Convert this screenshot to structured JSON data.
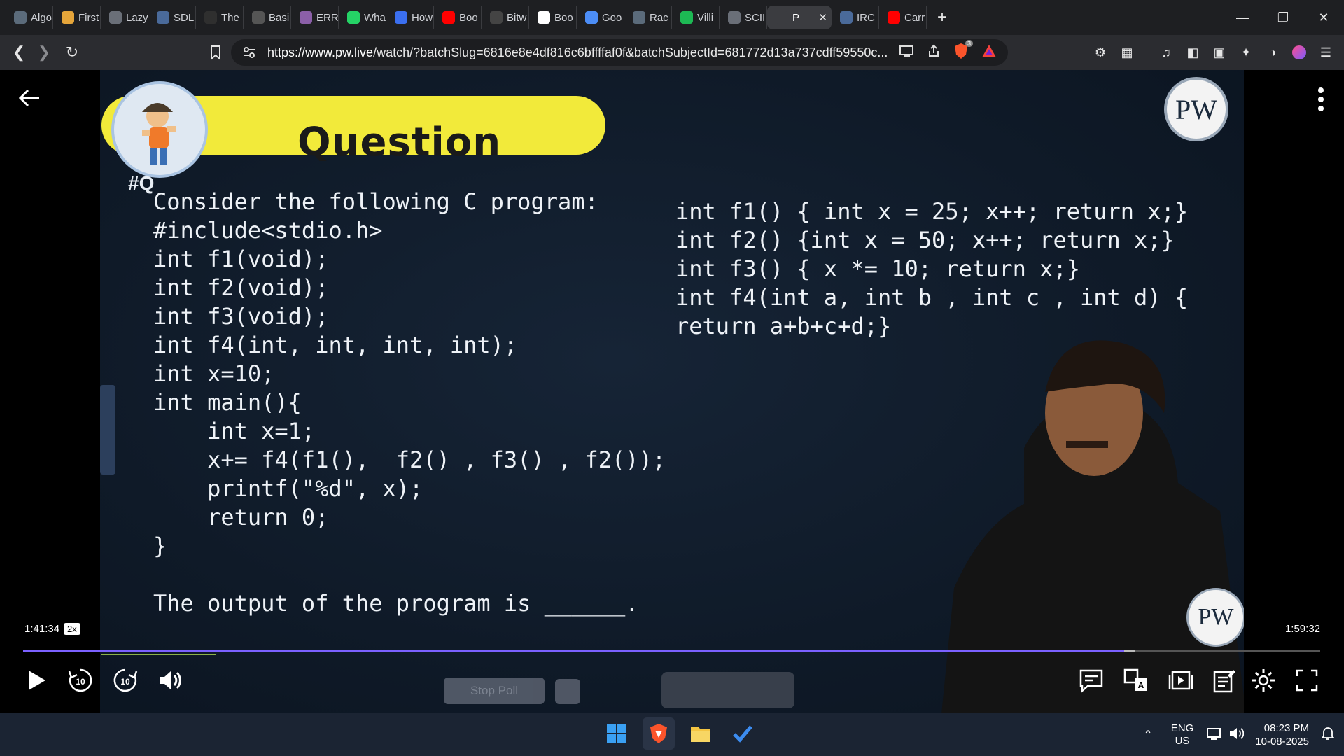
{
  "browser": {
    "tabs": [
      {
        "label": "Algo",
        "icon": "openai-icon",
        "color": "#5b6b7b"
      },
      {
        "label": "First",
        "icon": "bolt-icon",
        "color": "#e5a53a"
      },
      {
        "label": "Lazy",
        "icon": "globe-icon",
        "color": "#6a6f78"
      },
      {
        "label": "SDL",
        "icon": "image-icon",
        "color": "#4a6a9a"
      },
      {
        "label": "The",
        "icon": "w3-icon",
        "color": "#2f2f2f"
      },
      {
        "label": "Basi",
        "icon": "image-icon",
        "color": "#555"
      },
      {
        "label": "ERR",
        "icon": "mushroom-icon",
        "color": "#8b5fa8"
      },
      {
        "label": "Wha",
        "icon": "whatsapp-icon",
        "color": "#25d366"
      },
      {
        "label": "How",
        "icon": "bookmark-icon",
        "color": "#3b6ff0"
      },
      {
        "label": "Boo",
        "icon": "youtube-icon",
        "color": "#ff0000"
      },
      {
        "label": "Bitw",
        "icon": "text-icon",
        "color": "#444"
      },
      {
        "label": "Boo",
        "icon": "google-icon",
        "color": "#ffffff"
      },
      {
        "label": "Goo",
        "icon": "gemini-icon",
        "color": "#4c8df6"
      },
      {
        "label": "Rac",
        "icon": "openai-icon",
        "color": "#5b6b7b"
      },
      {
        "label": "Villi",
        "icon": "spotify-icon",
        "color": "#1db954"
      },
      {
        "label": "SCII",
        "icon": "globe-icon",
        "color": "#6a6f78"
      },
      {
        "label": "P",
        "icon": "speaker-icon",
        "color": "#3b3c40",
        "active": true
      },
      {
        "label": "IRC",
        "icon": "image-icon",
        "color": "#4a6a9a"
      },
      {
        "label": "Carr",
        "icon": "youtube-icon",
        "color": "#ff0000"
      }
    ],
    "new_tab": "+",
    "url_host": "https://www.pw.live",
    "url_rest": "/watch/?batchSlug=6816e8e4df816c6bffffaf0f&batchSubjectId=681772d13a737cdff59550c...",
    "brave_badge": "3"
  },
  "slide": {
    "banner_title": "Question",
    "question_label": "#Q",
    "left_code": [
      "Consider the following C program:",
      "#include<stdio.h>",
      "int f1(void);",
      "int f2(void);",
      "int f3(void);",
      "int f4(int, int, int, int);",
      "int x=10;",
      "int main(){",
      "    int x=1;",
      "    x+= f4(f1(),  f2() , f3() , f2());",
      "    printf(\"%d\", x);",
      "    return 0;",
      "}",
      "",
      "The output of the program is ______."
    ],
    "right_code": [
      "int f1() { int x = 25; x++; return x;}",
      "int f2() {int x = 50; x++; return x;}",
      "int f3() { x *= 10; return x;}",
      "int f4(int a, int b , int c , int d) {",
      "return a+b+c+d;}"
    ],
    "logo_text": "PW"
  },
  "player": {
    "current_time": "1:41:34",
    "speed": "2x",
    "duration": "1:59:32",
    "progress": 0.849,
    "buffer_end": 0.857,
    "skip_back": "10",
    "skip_forward": "10",
    "stop_poll_label": "Stop Poll",
    "accent": "#7b61ff"
  },
  "taskbar": {
    "lang_top": "ENG",
    "lang_bottom": "US",
    "time": "08:23 PM",
    "date": "10-08-2025"
  }
}
